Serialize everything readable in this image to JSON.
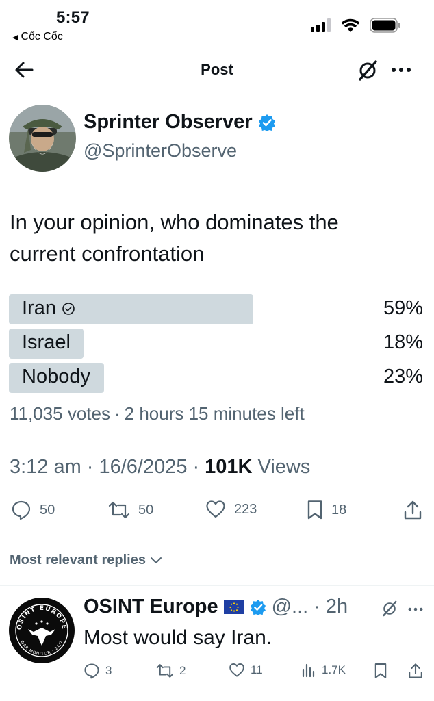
{
  "status_bar": {
    "time": "5:57",
    "back_app": "Cốc Cốc"
  },
  "nav": {
    "title": "Post",
    "back_icon": "arrow-left-icon",
    "grok_icon": "grok-icon",
    "more_icon": "more-icon"
  },
  "author": {
    "name": "Sprinter Observer",
    "handle": "@SprinterObserve",
    "verified": true,
    "badge_color": "#1d9bf0"
  },
  "post": {
    "text_line1": "In your opinion, who dominates the",
    "text_line2": "current confrontation"
  },
  "poll": {
    "options": [
      {
        "label": "Iran",
        "percent_label": "59%",
        "percent": 59,
        "winner": true
      },
      {
        "label": "Israel",
        "percent_label": "18%",
        "percent": 18,
        "winner": false
      },
      {
        "label": "Nobody",
        "percent_label": "23%",
        "percent": 23,
        "winner": false
      }
    ],
    "votes": "11,035 votes",
    "separator": "·",
    "time_left": "2 hours 15 minutes left",
    "bar_color": "#cfd9de"
  },
  "meta": {
    "time": "3:12 am",
    "date": "16/6/2025",
    "views_count": "101K",
    "views_label": "Views",
    "separator": "·"
  },
  "actions": {
    "replies": "50",
    "reposts": "50",
    "likes": "223",
    "bookmarks": "18"
  },
  "replies_filter": {
    "label": "Most relevant replies"
  },
  "reply": {
    "name": "OSINT Europe",
    "flag_icon": "eu-flag-icon",
    "handle": "@...",
    "separator": "·",
    "time": "2h",
    "text": "Most would say Iran.",
    "avatar_top_text": "OSINT EUROPE",
    "avatar_bottom_text": "WAR MONITOR · 24/7",
    "actions": {
      "replies": "3",
      "reposts": "2",
      "likes": "11",
      "views": "1.7K"
    }
  },
  "colors": {
    "text": "#0f1419",
    "secondary": "#536471",
    "verified": "#1d9bf0",
    "divider": "#eff3f4"
  }
}
